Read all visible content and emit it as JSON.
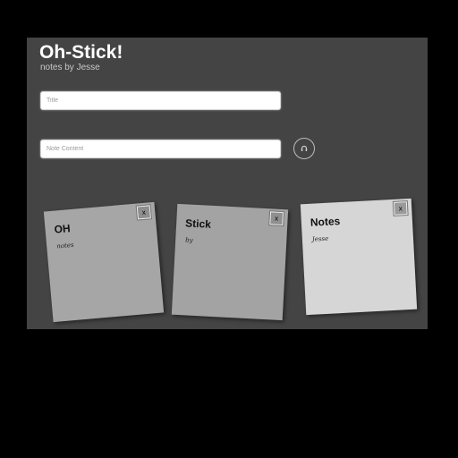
{
  "header": {
    "title": "Oh-Stick!",
    "subtitle": "notes by Jesse"
  },
  "form": {
    "title_placeholder": "Title",
    "content_placeholder": "Note Content",
    "add_icon": "add-note-icon"
  },
  "notes": [
    {
      "title": "OH",
      "body": "notes",
      "close_label": "x",
      "color": "#a6a6a6"
    },
    {
      "title": "Stick",
      "body": "by",
      "close_label": "x",
      "color": "#a3a3a3"
    },
    {
      "title": "Notes",
      "body": "Jesse",
      "close_label": "x",
      "color": "#d6d6d6"
    }
  ],
  "colors": {
    "page_background": "#000000",
    "app_background": "#444444",
    "title_text": "#ffffff"
  }
}
